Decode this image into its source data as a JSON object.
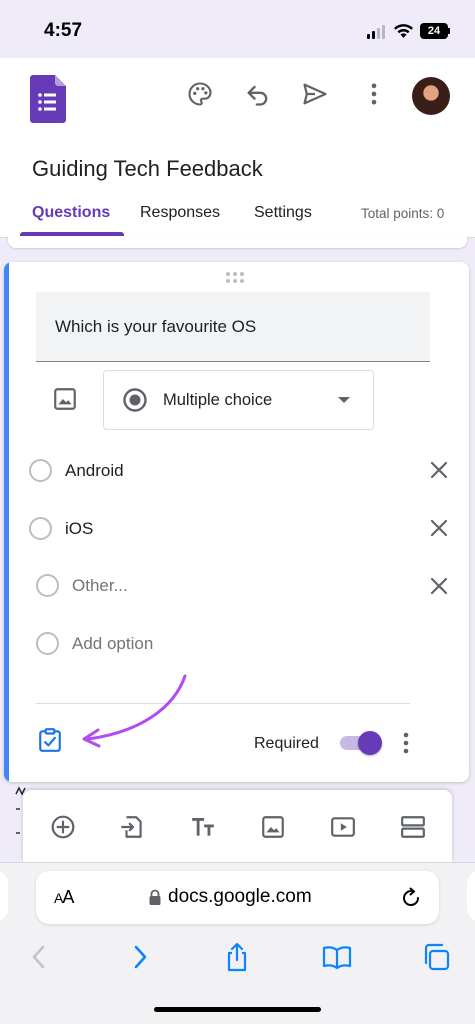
{
  "status_bar": {
    "time": "4:57",
    "battery": "24"
  },
  "header": {
    "form_title": "Guiding Tech Feedback",
    "icons": [
      "forms-logo",
      "palette-icon",
      "undo-icon",
      "send-icon",
      "more-vert-icon",
      "avatar"
    ]
  },
  "tabs": [
    {
      "label": "Questions",
      "active": true
    },
    {
      "label": "Responses",
      "active": false
    },
    {
      "label": "Settings",
      "active": false
    }
  ],
  "total_points": "Total points: 0",
  "question": {
    "title": "Which is your favourite OS",
    "type": "Multiple choice",
    "options": [
      "Android",
      "iOS"
    ],
    "other_placeholder": "Other...",
    "add_option": "Add option",
    "required_label": "Required",
    "required": true
  },
  "toolbar": {
    "icons": [
      "add-question-icon",
      "import-questions-icon",
      "add-title-icon",
      "add-image-icon",
      "add-video-icon",
      "add-section-icon"
    ]
  },
  "browser": {
    "aa_label_small": "A",
    "aa_label_large": "A",
    "url": "docs.google.com"
  },
  "colors": {
    "accent": "#673ab7",
    "card_accent": "#4285f4",
    "background": "#f0ebf8",
    "annotation_arrow": "#b04cf0",
    "safari_blue": "#0a84ff"
  }
}
